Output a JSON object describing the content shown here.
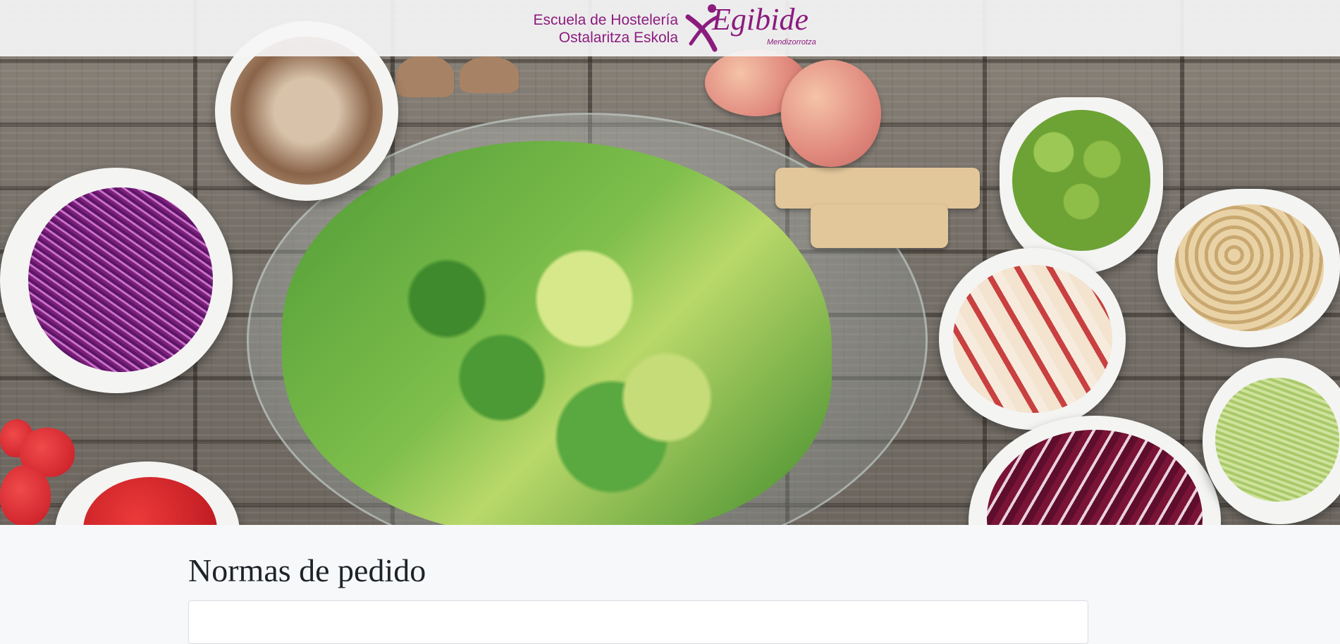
{
  "header": {
    "school_line_1": "Escuela de Hostelería",
    "school_line_2": "Ostalaritza Eskola",
    "brand": "Egibide",
    "brand_sub": "Mendizorrotza",
    "brand_color": "#8b1c7e"
  },
  "hero": {
    "image": "food-salad-photo"
  },
  "main": {
    "title": "Normas de pedido"
  }
}
